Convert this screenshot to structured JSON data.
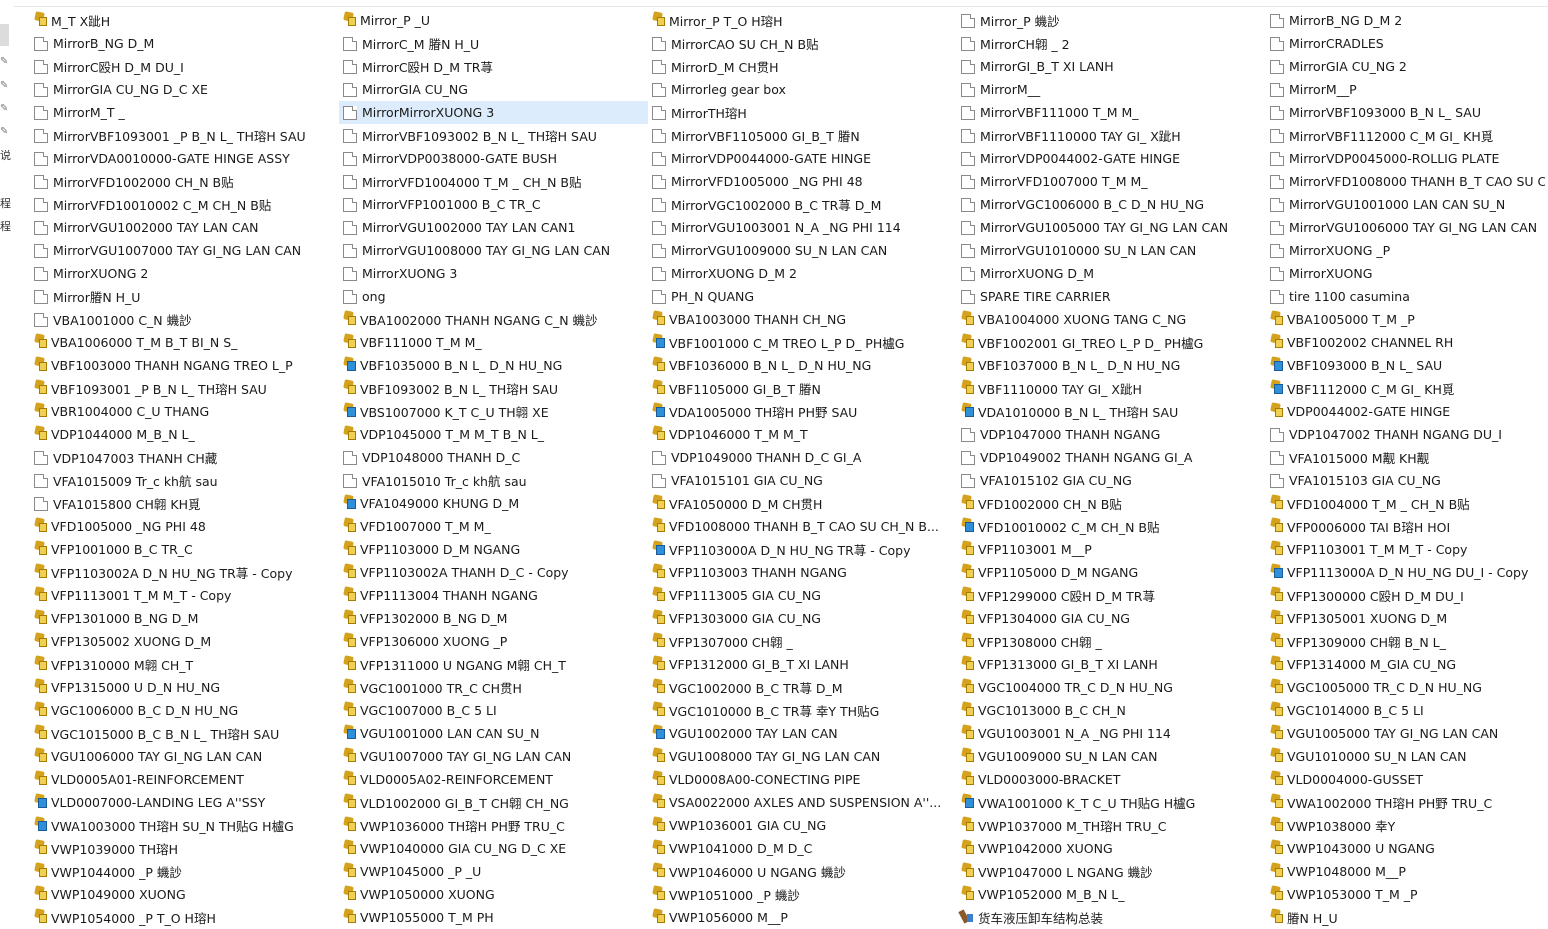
{
  "nav_pane": {
    "labels": [
      "说",
      "程",
      "程"
    ]
  },
  "files": [
    {
      "name": "M_T X跐H",
      "icon": "part-icon"
    },
    {
      "name": "Mirror_P _U",
      "icon": "part-icon"
    },
    {
      "name": "Mirror_P T_O H瑢H",
      "icon": "part-icon"
    },
    {
      "name": "Mirror_P 蟣訬",
      "icon": "document-icon"
    },
    {
      "name": "MirrorB_NG D_M 2",
      "icon": "document-icon"
    },
    {
      "name": "MirrorB_NG D_M",
      "icon": "document-icon"
    },
    {
      "name": "MirrorC_M 膡N H_U",
      "icon": "document-icon"
    },
    {
      "name": "MirrorCAO SU CH_N B贴",
      "icon": "document-icon"
    },
    {
      "name": "MirrorCH翶 _ 2",
      "icon": "document-icon"
    },
    {
      "name": "MirrorCRADLES",
      "icon": "document-icon"
    },
    {
      "name": "MirrorC殴H D_M DU_I",
      "icon": "document-icon"
    },
    {
      "name": "MirrorC殴H D_M TR荨",
      "icon": "document-icon"
    },
    {
      "name": "MirrorD_M CH贯H",
      "icon": "document-icon"
    },
    {
      "name": "MirrorGI_B_T XI LANH",
      "icon": "document-icon"
    },
    {
      "name": "MirrorGIA CU_NG 2",
      "icon": "document-icon"
    },
    {
      "name": "MirrorGIA CU_NG D_C XE",
      "icon": "document-icon"
    },
    {
      "name": "MirrorGIA CU_NG",
      "icon": "document-icon"
    },
    {
      "name": "Mirrorleg gear box",
      "icon": "document-icon"
    },
    {
      "name": "MirrorM__",
      "icon": "document-icon"
    },
    {
      "name": "MirrorM__P",
      "icon": "document-icon"
    },
    {
      "name": "MirrorM_T _",
      "icon": "document-icon"
    },
    {
      "name": "MirrorMirrorXUONG 3",
      "icon": "document-icon",
      "selected": true
    },
    {
      "name": "MirrorTH瑢H",
      "icon": "document-icon"
    },
    {
      "name": "MirrorVBF111000  T_M M_",
      "icon": "document-icon"
    },
    {
      "name": "MirrorVBF1093000  B_N L_ SAU",
      "icon": "document-icon"
    },
    {
      "name": "MirrorVBF1093001  _P B_N L_ TH瑢H SAU",
      "icon": "document-icon"
    },
    {
      "name": "MirrorVBF1093002  B_N L_ TH瑢H SAU",
      "icon": "document-icon"
    },
    {
      "name": "MirrorVBF1105000 GI_B_T 膡N",
      "icon": "document-icon"
    },
    {
      "name": "MirrorVBF1110000  TAY GI_ X跐H",
      "icon": "document-icon"
    },
    {
      "name": "MirrorVBF1112000  C_M GI_ KH覓",
      "icon": "document-icon"
    },
    {
      "name": "MirrorVDA0010000-GATE HINGE ASSY",
      "icon": "document-icon"
    },
    {
      "name": "MirrorVDP0038000-GATE BUSH",
      "icon": "document-icon"
    },
    {
      "name": "MirrorVDP0044000-GATE HINGE",
      "icon": "document-icon"
    },
    {
      "name": "MirrorVDP0044002-GATE HINGE",
      "icon": "document-icon"
    },
    {
      "name": "MirrorVDP0045000-ROLLIG PLATE",
      "icon": "document-icon"
    },
    {
      "name": "MirrorVFD1002000  CH_N B贴",
      "icon": "document-icon"
    },
    {
      "name": "MirrorVFD1004000  T_M _ CH_N B贴",
      "icon": "document-icon"
    },
    {
      "name": "MirrorVFD1005000  _NG PHI 48",
      "icon": "document-icon"
    },
    {
      "name": "MirrorVFD1007000  T_M M_",
      "icon": "document-icon"
    },
    {
      "name": "MirrorVFD1008000  THANH B_T CAO SU C...",
      "icon": "document-icon"
    },
    {
      "name": "MirrorVFD10010002  C_M CH_N B贴",
      "icon": "document-icon"
    },
    {
      "name": "MirrorVFP1001000  B_C TR_C",
      "icon": "document-icon"
    },
    {
      "name": "MirrorVGC1002000  B_C TR荨 D_M",
      "icon": "document-icon"
    },
    {
      "name": "MirrorVGC1006000  B_C D_N HU_NG",
      "icon": "document-icon"
    },
    {
      "name": "MirrorVGU1001000  LAN CAN SU_N",
      "icon": "document-icon"
    },
    {
      "name": "MirrorVGU1002000  TAY LAN CAN",
      "icon": "document-icon"
    },
    {
      "name": "MirrorVGU1002000  TAY LAN CAN1",
      "icon": "document-icon"
    },
    {
      "name": "MirrorVGU1003001  N_A _NG PHI 114",
      "icon": "document-icon"
    },
    {
      "name": "MirrorVGU1005000  TAY GI_NG LAN CAN",
      "icon": "document-icon"
    },
    {
      "name": "MirrorVGU1006000  TAY GI_NG LAN CAN",
      "icon": "document-icon"
    },
    {
      "name": "MirrorVGU1007000  TAY GI_NG LAN CAN",
      "icon": "document-icon"
    },
    {
      "name": "MirrorVGU1008000  TAY GI_NG LAN CAN",
      "icon": "document-icon"
    },
    {
      "name": "MirrorVGU1009000  SU_N LAN CAN",
      "icon": "document-icon"
    },
    {
      "name": "MirrorVGU1010000  SU_N LAN CAN",
      "icon": "document-icon"
    },
    {
      "name": "MirrorXUONG _P",
      "icon": "document-icon"
    },
    {
      "name": "MirrorXUONG 2",
      "icon": "document-icon"
    },
    {
      "name": "MirrorXUONG 3",
      "icon": "document-icon"
    },
    {
      "name": "MirrorXUONG D_M 2",
      "icon": "document-icon"
    },
    {
      "name": "MirrorXUONG D_M",
      "icon": "document-icon"
    },
    {
      "name": "MirrorXUONG",
      "icon": "document-icon"
    },
    {
      "name": "Mirror膡N H_U",
      "icon": "document-icon"
    },
    {
      "name": "ong",
      "icon": "document-icon"
    },
    {
      "name": "PH_N QUANG",
      "icon": "document-icon"
    },
    {
      "name": "SPARE TIRE CARRIER",
      "icon": "document-icon"
    },
    {
      "name": "tire 1100 casumina",
      "icon": "document-icon"
    },
    {
      "name": "VBA1001000  C_N 蟣訬",
      "icon": "document-icon"
    },
    {
      "name": "VBA1002000  THANH NGANG C_N 蟣訬",
      "icon": "part-icon"
    },
    {
      "name": "VBA1003000  THANH CH_NG",
      "icon": "part-icon"
    },
    {
      "name": "VBA1004000  XUONG TANG C_NG",
      "icon": "part-icon"
    },
    {
      "name": "VBA1005000  T_M _P",
      "icon": "part-icon"
    },
    {
      "name": "VBA1006000  T_M B_T BI_N S_",
      "icon": "part-icon"
    },
    {
      "name": "VBF111000  T_M M_",
      "icon": "part-icon"
    },
    {
      "name": "VBF1001000  C_M TREO L_P D_ PH櫨G",
      "icon": "assembly-icon"
    },
    {
      "name": "VBF1002001  GI_TREO L_P D_ PH櫨G",
      "icon": "part-icon"
    },
    {
      "name": "VBF1002002  CHANNEL RH",
      "icon": "part-icon"
    },
    {
      "name": "VBF1003000  THANH NGANG TREO L_P",
      "icon": "part-icon"
    },
    {
      "name": "VBF1035000  B_N L_ D_N HU_NG",
      "icon": "assembly-icon"
    },
    {
      "name": "VBF1036000  B_N L_ D_N HU_NG",
      "icon": "part-icon"
    },
    {
      "name": "VBF1037000  B_N L_ D_N HU_NG",
      "icon": "part-icon"
    },
    {
      "name": "VBF1093000  B_N L_ SAU",
      "icon": "assembly-icon"
    },
    {
      "name": "VBF1093001  _P B_N L_ TH瑢H SAU",
      "icon": "part-icon"
    },
    {
      "name": "VBF1093002  B_N L_ TH瑢H SAU",
      "icon": "part-icon"
    },
    {
      "name": "VBF1105000 GI_B_T 膡N",
      "icon": "part-icon"
    },
    {
      "name": "VBF1110000  TAY GI_ X跐H",
      "icon": "part-icon"
    },
    {
      "name": "VBF1112000  C_M GI_ KH覓",
      "icon": "assembly-icon"
    },
    {
      "name": "VBR1004000  C_U THANG",
      "icon": "part-icon"
    },
    {
      "name": "VBS1007000  K_T C_U TH翶 XE",
      "icon": "assembly-icon"
    },
    {
      "name": "VDA1005000  TH瑢H PH野 SAU",
      "icon": "assembly-icon"
    },
    {
      "name": "VDA1010000  B_N L_ TH瑢H SAU",
      "icon": "assembly-icon"
    },
    {
      "name": "VDP0044002-GATE HINGE",
      "icon": "part-icon"
    },
    {
      "name": "VDP1044000  M_B_N L_",
      "icon": "part-icon"
    },
    {
      "name": "VDP1045000  T_M M_T B_N L_",
      "icon": "part-icon"
    },
    {
      "name": "VDP1046000  T_M M_T",
      "icon": "part-icon"
    },
    {
      "name": "VDP1047000  THANH NGANG",
      "icon": "document-icon"
    },
    {
      "name": "VDP1047002  THANH NGANG DU_I",
      "icon": "document-icon"
    },
    {
      "name": "VDP1047003  THANH CH藏",
      "icon": "document-icon"
    },
    {
      "name": "VDP1048000  THANH D_C",
      "icon": "document-icon"
    },
    {
      "name": "VDP1049000  THANH D_C GI_A",
      "icon": "document-icon"
    },
    {
      "name": "VDP1049002  THANH NGANG GI_A",
      "icon": "document-icon"
    },
    {
      "name": "VFA1015000  M觏 KH觏",
      "icon": "document-icon"
    },
    {
      "name": "VFA1015009  Tr_c kh航 sau",
      "icon": "document-icon"
    },
    {
      "name": "VFA1015010  Tr_c kh航 sau",
      "icon": "document-icon"
    },
    {
      "name": "VFA1015101  GIA CU_NG",
      "icon": "document-icon"
    },
    {
      "name": "VFA1015102 GIA CU_NG",
      "icon": "document-icon"
    },
    {
      "name": "VFA1015103 GIA CU_NG",
      "icon": "document-icon"
    },
    {
      "name": "VFA1015800  CH翶 KH覓",
      "icon": "document-icon"
    },
    {
      "name": "VFA1049000  KHUNG D_M",
      "icon": "assembly-icon"
    },
    {
      "name": "VFA1050000  D_M CH贯H",
      "icon": "part-icon"
    },
    {
      "name": "VFD1002000  CH_N B贴",
      "icon": "part-icon"
    },
    {
      "name": "VFD1004000  T_M _ CH_N B贴",
      "icon": "part-icon"
    },
    {
      "name": "VFD1005000  _NG PHI 48",
      "icon": "part-icon"
    },
    {
      "name": "VFD1007000  T_M M_",
      "icon": "part-icon"
    },
    {
      "name": "VFD1008000  THANH B_T CAO SU CH_N B...",
      "icon": "part-icon"
    },
    {
      "name": "VFD10010002  C_M CH_N B贴",
      "icon": "assembly-icon"
    },
    {
      "name": "VFP0006000  TAI B瑢H HOI",
      "icon": "part-icon"
    },
    {
      "name": "VFP1001000  B_C TR_C",
      "icon": "part-icon"
    },
    {
      "name": "VFP1103000  D_M NGANG",
      "icon": "part-icon"
    },
    {
      "name": "VFP1103000A  D_N HU_NG TR荨 - Copy",
      "icon": "assembly-icon"
    },
    {
      "name": "VFP1103001  M__P",
      "icon": "part-icon"
    },
    {
      "name": "VFP1103001  T_M M_T - Copy",
      "icon": "part-icon"
    },
    {
      "name": "VFP1103002A  D_N HU_NG TR荨 - Copy",
      "icon": "part-icon"
    },
    {
      "name": "VFP1103002A  THANH D_C - Copy",
      "icon": "part-icon"
    },
    {
      "name": "VFP1103003  THANH NGANG",
      "icon": "part-icon"
    },
    {
      "name": "VFP1105000 D_M NGANG",
      "icon": "part-icon"
    },
    {
      "name": "VFP1113000A  D_N HU_NG DU_I - Copy",
      "icon": "assembly-icon"
    },
    {
      "name": "VFP1113001  T_M M_T - Copy",
      "icon": "part-icon"
    },
    {
      "name": "VFP1113004  THANH NGANG",
      "icon": "part-icon"
    },
    {
      "name": "VFP1113005  GIA CU_NG",
      "icon": "part-icon"
    },
    {
      "name": "VFP1299000  C殴H D_M TR荨",
      "icon": "part-icon"
    },
    {
      "name": "VFP1300000  C殴H D_M DU_I",
      "icon": "part-icon"
    },
    {
      "name": "VFP1301000  B_NG D_M",
      "icon": "part-icon"
    },
    {
      "name": "VFP1302000  B_NG D_M",
      "icon": "part-icon"
    },
    {
      "name": "VFP1303000  GIA CU_NG",
      "icon": "part-icon"
    },
    {
      "name": "VFP1304000  GIA CU_NG",
      "icon": "part-icon"
    },
    {
      "name": "VFP1305001 XUONG D_M",
      "icon": "part-icon"
    },
    {
      "name": "VFP1305002  XUONG D_M",
      "icon": "part-icon"
    },
    {
      "name": "VFP1306000  XUONG _P",
      "icon": "part-icon"
    },
    {
      "name": "VFP1307000  CH翶 _",
      "icon": "part-icon"
    },
    {
      "name": "VFP1308000  CH翶 _",
      "icon": "part-icon"
    },
    {
      "name": "VFP1309000  CH翶 B_N L_",
      "icon": "part-icon"
    },
    {
      "name": "VFP1310000  M翶 CH_T",
      "icon": "part-icon"
    },
    {
      "name": "VFP1311000  U NGANG M翶 CH_T",
      "icon": "part-icon"
    },
    {
      "name": "VFP1312000  GI_B_T XI LANH",
      "icon": "part-icon"
    },
    {
      "name": "VFP1313000  GI_B_T XI LANH",
      "icon": "part-icon"
    },
    {
      "name": "VFP1314000  M_GIA CU_NG",
      "icon": "part-icon"
    },
    {
      "name": "VFP1315000  U D_N HU_NG",
      "icon": "part-icon"
    },
    {
      "name": "VGC1001000 TR_C CH贯H",
      "icon": "part-icon"
    },
    {
      "name": "VGC1002000  B_C TR荨 D_M",
      "icon": "part-icon"
    },
    {
      "name": "VGC1004000  TR_C D_N HU_NG",
      "icon": "part-icon"
    },
    {
      "name": "VGC1005000  TR_C D_N HU_NG",
      "icon": "part-icon"
    },
    {
      "name": "VGC1006000  B_C D_N HU_NG",
      "icon": "part-icon"
    },
    {
      "name": "VGC1007000  B_C 5 LI",
      "icon": "part-icon"
    },
    {
      "name": "VGC1010000  B_C TR荨 幸Y TH贴G",
      "icon": "part-icon"
    },
    {
      "name": "VGC1013000  B_C CH_N",
      "icon": "part-icon"
    },
    {
      "name": "VGC1014000  B_C 5 LI",
      "icon": "part-icon"
    },
    {
      "name": "VGC1015000  B_C B_N L_ TH瑢H SAU",
      "icon": "part-icon"
    },
    {
      "name": "VGU1001000  LAN CAN SU_N",
      "icon": "assembly-icon"
    },
    {
      "name": "VGU1002000  TAY LAN CAN",
      "icon": "assembly-icon"
    },
    {
      "name": "VGU1003001  N_A _NG PHI 114",
      "icon": "part-icon"
    },
    {
      "name": "VGU1005000  TAY GI_NG LAN CAN",
      "icon": "part-icon"
    },
    {
      "name": "VGU1006000  TAY GI_NG LAN CAN",
      "icon": "part-icon"
    },
    {
      "name": "VGU1007000  TAY GI_NG LAN CAN",
      "icon": "part-icon"
    },
    {
      "name": "VGU1008000  TAY GI_NG LAN CAN",
      "icon": "part-icon"
    },
    {
      "name": "VGU1009000  SU_N LAN CAN",
      "icon": "part-icon"
    },
    {
      "name": "VGU1010000  SU_N LAN CAN",
      "icon": "part-icon"
    },
    {
      "name": "VLD0005A01-REINFORCEMENT",
      "icon": "part-icon"
    },
    {
      "name": "VLD0005A02-REINFORCEMENT",
      "icon": "part-icon"
    },
    {
      "name": "VLD0008A00-CONECTING PIPE",
      "icon": "part-icon"
    },
    {
      "name": "VLD0003000-BRACKET",
      "icon": "part-icon"
    },
    {
      "name": "VLD0004000-GUSSET",
      "icon": "part-icon"
    },
    {
      "name": "VLD0007000-LANDING LEG A''SSY",
      "icon": "assembly-icon"
    },
    {
      "name": "VLD1002000 GI_B_T CH翶 CH_NG",
      "icon": "part-icon"
    },
    {
      "name": "VSA0022000 AXLES AND SUSPENSION A''...",
      "icon": "part-icon"
    },
    {
      "name": "VWA1001000  K_T C_U TH贴G H櫨G",
      "icon": "assembly-icon"
    },
    {
      "name": "VWA1002000  TH瑢H PH野 TRU_C",
      "icon": "part-icon"
    },
    {
      "name": "VWA1003000  TH瑢H SU_N TH贴G H櫨G",
      "icon": "assembly-icon"
    },
    {
      "name": "VWP1036000  TH瑢H PH野 TRU_C",
      "icon": "part-icon"
    },
    {
      "name": "VWP1036001  GIA CU_NG",
      "icon": "part-icon"
    },
    {
      "name": "VWP1037000  M_TH瑢H TRU_C",
      "icon": "part-icon"
    },
    {
      "name": "VWP1038000 幸Y",
      "icon": "part-icon"
    },
    {
      "name": "VWP1039000  TH瑢H",
      "icon": "part-icon"
    },
    {
      "name": "VWP1040000  GIA CU_NG D_C XE",
      "icon": "part-icon"
    },
    {
      "name": "VWP1041000  D_M D_C",
      "icon": "part-icon"
    },
    {
      "name": "VWP1042000  XUONG",
      "icon": "part-icon"
    },
    {
      "name": "VWP1043000  U NGANG",
      "icon": "part-icon"
    },
    {
      "name": "VWP1044000  _P 蟣訬",
      "icon": "part-icon"
    },
    {
      "name": "VWP1045000  _P _U",
      "icon": "part-icon"
    },
    {
      "name": "VWP1046000  U NGANG 蟣訬",
      "icon": "part-icon"
    },
    {
      "name": "VWP1047000  L NGANG 蟣訬",
      "icon": "part-icon"
    },
    {
      "name": "VWP1048000  M__P",
      "icon": "part-icon"
    },
    {
      "name": "VWP1049000  XUONG",
      "icon": "part-icon"
    },
    {
      "name": "VWP1050000  XUONG",
      "icon": "part-icon"
    },
    {
      "name": "VWP1051000  _P 蟣訬",
      "icon": "part-icon"
    },
    {
      "name": "VWP1052000  M_B_N L_",
      "icon": "part-icon"
    },
    {
      "name": "VWP1053000  T_M _P",
      "icon": "part-icon"
    },
    {
      "name": "VWP1054000  _P T_O H瑢H",
      "icon": "part-icon"
    },
    {
      "name": "VWP1055000  T_M PH",
      "icon": "part-icon"
    },
    {
      "name": "VWP1056000  M__P",
      "icon": "part-icon"
    },
    {
      "name": "货车液压卸车结构总装",
      "icon": "drawing-icon"
    },
    {
      "name": "膡N H_U",
      "icon": "part-icon"
    }
  ]
}
